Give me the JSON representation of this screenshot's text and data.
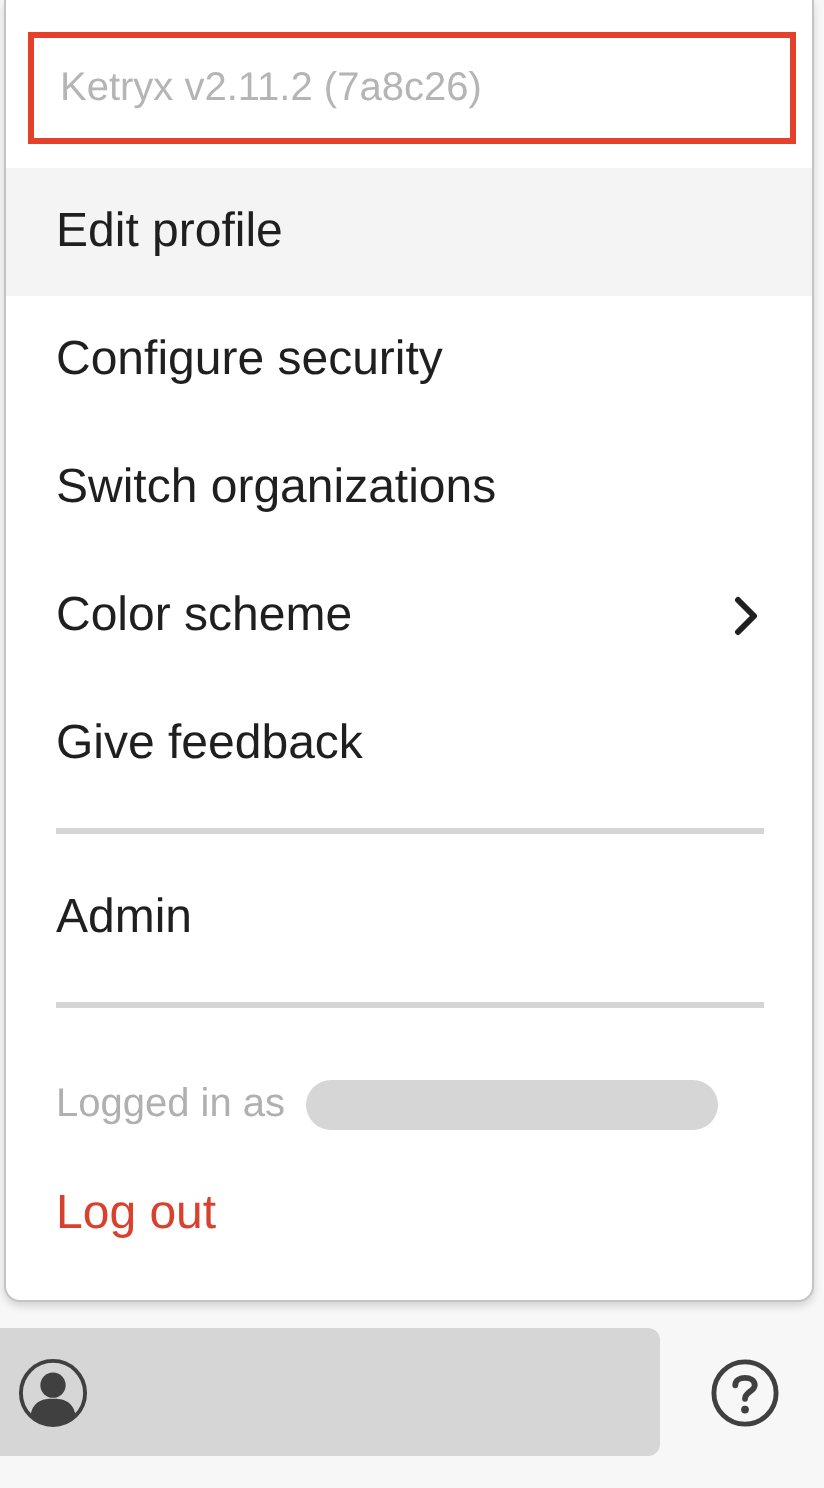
{
  "menu": {
    "version": {
      "text": "Ketryx v2.11.2 (7a8c26)",
      "highlighted": true
    },
    "groups": [
      {
        "items": [
          {
            "label": "Edit profile",
            "hovered": true,
            "submenu": false
          },
          {
            "label": "Configure security",
            "hovered": false,
            "submenu": false
          },
          {
            "label": "Switch organizations",
            "hovered": false,
            "submenu": false
          },
          {
            "label": "Color scheme",
            "hovered": false,
            "submenu": true
          },
          {
            "label": "Give feedback",
            "hovered": false,
            "submenu": false
          }
        ]
      },
      {
        "items": [
          {
            "label": "Admin",
            "hovered": false,
            "submenu": false
          }
        ]
      }
    ],
    "logged_in_as": "Logged in as",
    "log_out": "Log out"
  }
}
